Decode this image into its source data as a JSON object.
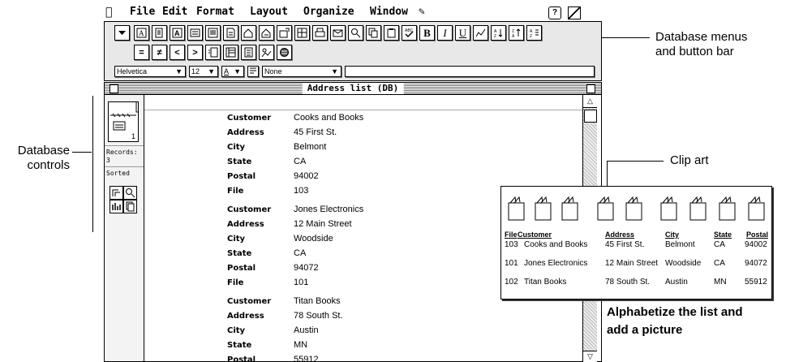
{
  "menubar": {
    "items": [
      "File",
      "Edit",
      "Format",
      "Layout",
      "Organize",
      "Window"
    ]
  },
  "toolbar": {
    "font": "Helvetica",
    "size": "12",
    "text_color": "A",
    "style": "None",
    "bold": "B",
    "italic": "I",
    "underline": "U",
    "equal": "=",
    "not_equal": "≠",
    "less": "<",
    "greater": ">"
  },
  "window": {
    "title": "Address list (DB)"
  },
  "sidebar": {
    "page_number": "1",
    "records_label": "Records:",
    "records_count": "3",
    "sorted_label": "Sorted"
  },
  "labels": {
    "customer": "Customer",
    "address": "Address",
    "city": "City",
    "state": "State",
    "postal": "Postal",
    "file": "File"
  },
  "records": [
    {
      "customer": "Cooks and Books",
      "address": "45 First St.",
      "city": "Belmont",
      "state": "CA",
      "postal": "94002",
      "file": "103"
    },
    {
      "customer": "Jones Electronics",
      "address": "12 Main Street",
      "city": "Woodside",
      "state": "CA",
      "postal": "94072",
      "file": "101"
    },
    {
      "customer": "Titan Books",
      "address": "78 South St.",
      "city": "Austin",
      "state": "MN",
      "postal": "55912"
    }
  ],
  "callouts": {
    "menus_line1": "Database menus",
    "menus_line2": "and button bar",
    "controls_line1": "Database",
    "controls_line2": "controls",
    "clip_art": "Clip art",
    "alpha_line1": "Alphabetize the list and",
    "alpha_line2": "add a picture"
  },
  "clip_table": {
    "headers": [
      "File",
      "Customer",
      "Address",
      "City",
      "State",
      "Postal"
    ],
    "rows": [
      [
        "103",
        "Cooks and Books",
        "45 First St.",
        "Belmont",
        "CA",
        "94002"
      ],
      [
        "101",
        "Jones Electronics",
        "12 Main Street",
        "Woodside",
        "CA",
        "94072"
      ],
      [
        "102",
        "Titan Books",
        "78 South St.",
        "Austin",
        "MN",
        "55912"
      ]
    ]
  }
}
